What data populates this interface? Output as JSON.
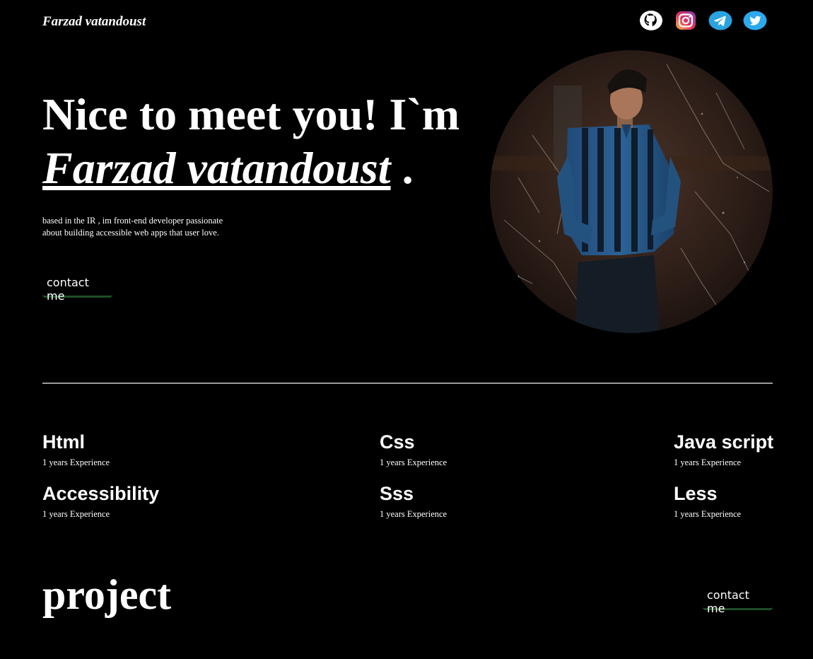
{
  "header": {
    "brand": "Farzad vatandoust",
    "socials": [
      {
        "icon": "github-icon"
      },
      {
        "icon": "instagram-icon"
      },
      {
        "icon": "telegram-icon"
      },
      {
        "icon": "twitter-icon"
      }
    ]
  },
  "hero": {
    "title_prefix": "Nice to meet you! I`m",
    "name": "Farzad vatandoust",
    "title_suffix": " .",
    "tagline": "based in the IR , im front-end developer passionate about building accessible web apps that user love.",
    "contact_label": "contact me"
  },
  "skills": [
    {
      "name": "Html",
      "experience": "1 years Experience"
    },
    {
      "name": "Css",
      "experience": "1 years Experience"
    },
    {
      "name": "Java script",
      "experience": "1 years Experience"
    },
    {
      "name": "Accessibility",
      "experience": "1 years Experience"
    },
    {
      "name": "Sss",
      "experience": "1 years Experience"
    },
    {
      "name": "Less",
      "experience": "1 years Experience"
    }
  ],
  "projects": {
    "title": "project",
    "contact_label": "contact me"
  },
  "colors": {
    "background": "#000000",
    "text": "#ffffff",
    "divider": "#9a9a9a",
    "button_underline": "#1f4d28",
    "telegram": "#2aa3e0",
    "twitter": "#2da9ee"
  }
}
